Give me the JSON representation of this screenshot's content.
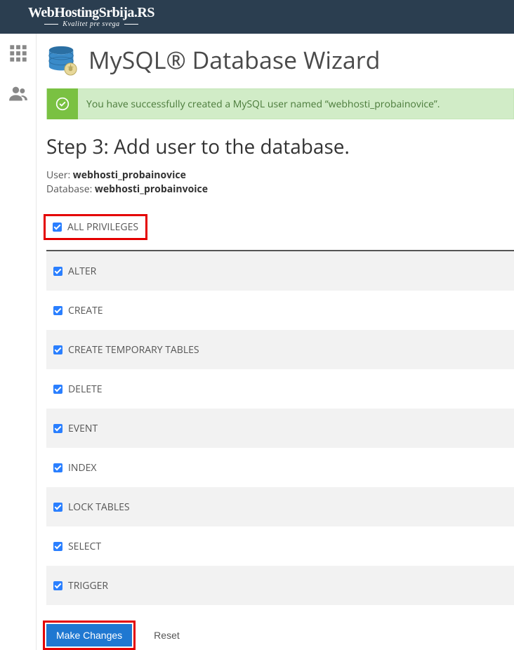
{
  "logo": {
    "main": "WebHostingSrbija.RS",
    "tagline": "Kvalitet pre svega"
  },
  "page_title": "MySQL® Database Wizard",
  "alert": {
    "text": "You have successfully created a MySQL user named “webhosti_probainovice”."
  },
  "step_title": "Step 3: Add user to the database.",
  "user_label": "User: ",
  "user_name": "webhosti_probainovice",
  "db_label": "Database: ",
  "db_name": "webhosti_probainvoice",
  "all_privileges_label": "ALL PRIVILEGES",
  "privileges": [
    {
      "label": "ALTER"
    },
    {
      "label": "CREATE"
    },
    {
      "label": "CREATE TEMPORARY TABLES"
    },
    {
      "label": "DELETE"
    },
    {
      "label": "EVENT"
    },
    {
      "label": "INDEX"
    },
    {
      "label": "LOCK TABLES"
    },
    {
      "label": "SELECT"
    },
    {
      "label": "TRIGGER"
    }
  ],
  "buttons": {
    "make_changes": "Make Changes",
    "reset": "Reset"
  }
}
